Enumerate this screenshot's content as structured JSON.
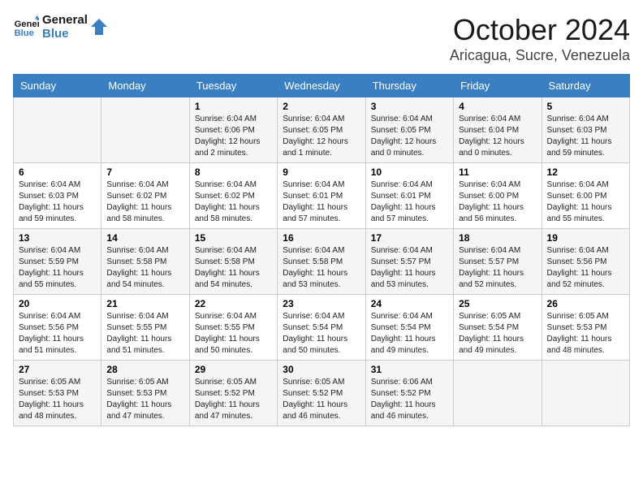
{
  "header": {
    "logo_line1": "General",
    "logo_line2": "Blue",
    "month": "October 2024",
    "location": "Aricagua, Sucre, Venezuela"
  },
  "weekdays": [
    "Sunday",
    "Monday",
    "Tuesday",
    "Wednesday",
    "Thursday",
    "Friday",
    "Saturday"
  ],
  "weeks": [
    [
      {
        "day": "",
        "info": ""
      },
      {
        "day": "",
        "info": ""
      },
      {
        "day": "1",
        "info": "Sunrise: 6:04 AM\nSunset: 6:06 PM\nDaylight: 12 hours\nand 2 minutes."
      },
      {
        "day": "2",
        "info": "Sunrise: 6:04 AM\nSunset: 6:05 PM\nDaylight: 12 hours\nand 1 minute."
      },
      {
        "day": "3",
        "info": "Sunrise: 6:04 AM\nSunset: 6:05 PM\nDaylight: 12 hours\nand 0 minutes."
      },
      {
        "day": "4",
        "info": "Sunrise: 6:04 AM\nSunset: 6:04 PM\nDaylight: 12 hours\nand 0 minutes."
      },
      {
        "day": "5",
        "info": "Sunrise: 6:04 AM\nSunset: 6:03 PM\nDaylight: 11 hours\nand 59 minutes."
      }
    ],
    [
      {
        "day": "6",
        "info": "Sunrise: 6:04 AM\nSunset: 6:03 PM\nDaylight: 11 hours\nand 59 minutes."
      },
      {
        "day": "7",
        "info": "Sunrise: 6:04 AM\nSunset: 6:02 PM\nDaylight: 11 hours\nand 58 minutes."
      },
      {
        "day": "8",
        "info": "Sunrise: 6:04 AM\nSunset: 6:02 PM\nDaylight: 11 hours\nand 58 minutes."
      },
      {
        "day": "9",
        "info": "Sunrise: 6:04 AM\nSunset: 6:01 PM\nDaylight: 11 hours\nand 57 minutes."
      },
      {
        "day": "10",
        "info": "Sunrise: 6:04 AM\nSunset: 6:01 PM\nDaylight: 11 hours\nand 57 minutes."
      },
      {
        "day": "11",
        "info": "Sunrise: 6:04 AM\nSunset: 6:00 PM\nDaylight: 11 hours\nand 56 minutes."
      },
      {
        "day": "12",
        "info": "Sunrise: 6:04 AM\nSunset: 6:00 PM\nDaylight: 11 hours\nand 55 minutes."
      }
    ],
    [
      {
        "day": "13",
        "info": "Sunrise: 6:04 AM\nSunset: 5:59 PM\nDaylight: 11 hours\nand 55 minutes."
      },
      {
        "day": "14",
        "info": "Sunrise: 6:04 AM\nSunset: 5:58 PM\nDaylight: 11 hours\nand 54 minutes."
      },
      {
        "day": "15",
        "info": "Sunrise: 6:04 AM\nSunset: 5:58 PM\nDaylight: 11 hours\nand 54 minutes."
      },
      {
        "day": "16",
        "info": "Sunrise: 6:04 AM\nSunset: 5:58 PM\nDaylight: 11 hours\nand 53 minutes."
      },
      {
        "day": "17",
        "info": "Sunrise: 6:04 AM\nSunset: 5:57 PM\nDaylight: 11 hours\nand 53 minutes."
      },
      {
        "day": "18",
        "info": "Sunrise: 6:04 AM\nSunset: 5:57 PM\nDaylight: 11 hours\nand 52 minutes."
      },
      {
        "day": "19",
        "info": "Sunrise: 6:04 AM\nSunset: 5:56 PM\nDaylight: 11 hours\nand 52 minutes."
      }
    ],
    [
      {
        "day": "20",
        "info": "Sunrise: 6:04 AM\nSunset: 5:56 PM\nDaylight: 11 hours\nand 51 minutes."
      },
      {
        "day": "21",
        "info": "Sunrise: 6:04 AM\nSunset: 5:55 PM\nDaylight: 11 hours\nand 51 minutes."
      },
      {
        "day": "22",
        "info": "Sunrise: 6:04 AM\nSunset: 5:55 PM\nDaylight: 11 hours\nand 50 minutes."
      },
      {
        "day": "23",
        "info": "Sunrise: 6:04 AM\nSunset: 5:54 PM\nDaylight: 11 hours\nand 50 minutes."
      },
      {
        "day": "24",
        "info": "Sunrise: 6:04 AM\nSunset: 5:54 PM\nDaylight: 11 hours\nand 49 minutes."
      },
      {
        "day": "25",
        "info": "Sunrise: 6:05 AM\nSunset: 5:54 PM\nDaylight: 11 hours\nand 49 minutes."
      },
      {
        "day": "26",
        "info": "Sunrise: 6:05 AM\nSunset: 5:53 PM\nDaylight: 11 hours\nand 48 minutes."
      }
    ],
    [
      {
        "day": "27",
        "info": "Sunrise: 6:05 AM\nSunset: 5:53 PM\nDaylight: 11 hours\nand 48 minutes."
      },
      {
        "day": "28",
        "info": "Sunrise: 6:05 AM\nSunset: 5:53 PM\nDaylight: 11 hours\nand 47 minutes."
      },
      {
        "day": "29",
        "info": "Sunrise: 6:05 AM\nSunset: 5:52 PM\nDaylight: 11 hours\nand 47 minutes."
      },
      {
        "day": "30",
        "info": "Sunrise: 6:05 AM\nSunset: 5:52 PM\nDaylight: 11 hours\nand 46 minutes."
      },
      {
        "day": "31",
        "info": "Sunrise: 6:06 AM\nSunset: 5:52 PM\nDaylight: 11 hours\nand 46 minutes."
      },
      {
        "day": "",
        "info": ""
      },
      {
        "day": "",
        "info": ""
      }
    ]
  ]
}
